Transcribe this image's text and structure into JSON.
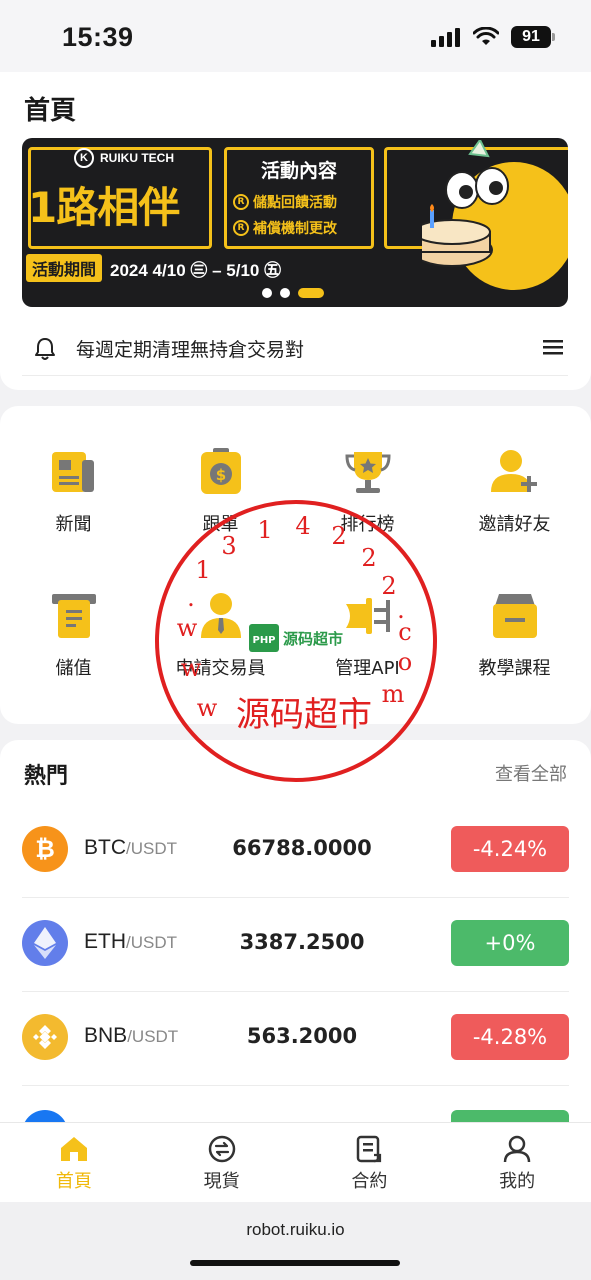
{
  "status": {
    "time": "15:39",
    "battery": "91"
  },
  "page": {
    "title": "首頁"
  },
  "banner": {
    "logo_text": "RUIKU TECH",
    "headline": "1路相伴",
    "content_title": "活動內容",
    "items": [
      "儲點回饋活動",
      "補償機制更改"
    ],
    "period_label": "活動期間",
    "period_dates": "2024 4/10 ㊂ – 5/10 ㊄"
  },
  "notice": {
    "text": "每週定期清理無持倉交易對"
  },
  "grid": [
    {
      "label": "新聞",
      "icon": "news-icon"
    },
    {
      "label": "跟單",
      "icon": "copy-trade-icon"
    },
    {
      "label": "排行榜",
      "icon": "trophy-icon"
    },
    {
      "label": "邀請好友",
      "icon": "invite-user-icon"
    },
    {
      "label": "儲值",
      "icon": "deposit-icon"
    },
    {
      "label": "申請交易員",
      "icon": "trader-icon"
    },
    {
      "label": "管理API",
      "icon": "api-plug-icon"
    },
    {
      "label": "教學課程",
      "icon": "tutorial-icon"
    }
  ],
  "hot": {
    "title": "熱門",
    "view_all": "查看全部",
    "rows": [
      {
        "base": "BTC",
        "quote": "/USDT",
        "price": "66788.0000",
        "change": "-4.24%",
        "color": "#f7931a",
        "change_color": "#ef5b5b"
      },
      {
        "base": "ETH",
        "quote": "/USDT",
        "price": "3387.2500",
        "change": "+0%",
        "color": "#627eea",
        "change_color": "#4cba6a"
      },
      {
        "base": "BNB",
        "quote": "/USDT",
        "price": "563.2000",
        "change": "-4.28%",
        "color": "#f3ba2f",
        "change_color": "#ef5b5b"
      }
    ]
  },
  "nav": [
    {
      "label": "首頁",
      "icon": "home-icon",
      "active": true
    },
    {
      "label": "現貨",
      "icon": "spot-exchange-icon",
      "active": false
    },
    {
      "label": "合約",
      "icon": "contract-icon",
      "active": false
    },
    {
      "label": "我的",
      "icon": "profile-icon",
      "active": false
    }
  ],
  "url": "robot.ruiku.io",
  "stamp": {
    "text": "源码超市",
    "url": "www.1314222.com",
    "logo_text": "源码超市"
  },
  "colors": {
    "accent": "#f0b90b",
    "up": "#4cba6a",
    "down": "#ef5b5b",
    "stamp": "#e02020"
  }
}
